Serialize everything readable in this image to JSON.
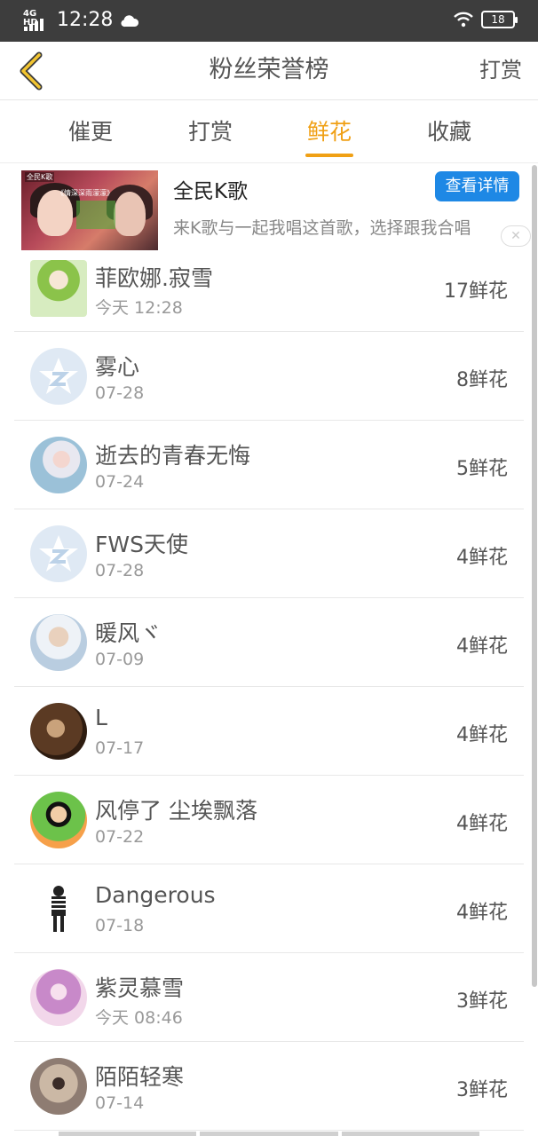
{
  "status_bar": {
    "network": "4G HD",
    "time": "12:28",
    "battery": "18"
  },
  "header": {
    "title": "粉丝荣誉榜",
    "right_action": "打赏"
  },
  "tabs": [
    {
      "label": "催更",
      "active": false
    },
    {
      "label": "打赏",
      "active": false
    },
    {
      "label": "鲜花",
      "active": true
    },
    {
      "label": "收藏",
      "active": false
    }
  ],
  "ad": {
    "title": "全民K歌",
    "button": "查看详情",
    "description": "来K歌与一起我唱这首歌，选择跟我合唱",
    "thumb_brand": "全民K歌",
    "thumb_caption": "《情深深雨濛濛》"
  },
  "fans": [
    {
      "name": "菲欧娜.寂雪",
      "date": "今天 12:28",
      "count": "17鲜花",
      "avatar": "anime-green"
    },
    {
      "name": "雾心",
      "date": "07-28",
      "count": "8鲜花",
      "avatar": "default-star"
    },
    {
      "name": "逝去的青春无悔",
      "date": "07-24",
      "count": "5鲜花",
      "avatar": "photo1"
    },
    {
      "name": "FWS天使",
      "date": "07-28",
      "count": "4鲜花",
      "avatar": "default-star"
    },
    {
      "name": "暖风ヾ",
      "date": "07-09",
      "count": "4鲜花",
      "avatar": "photo2"
    },
    {
      "name": "L",
      "date": "07-17",
      "count": "4鲜花",
      "avatar": "photo3"
    },
    {
      "name": "风停了 尘埃飘落",
      "date": "07-22",
      "count": "4鲜花",
      "avatar": "photo4"
    },
    {
      "name": "Dangerous",
      "date": "07-18",
      "count": "4鲜花",
      "avatar": "photo5"
    },
    {
      "name": "紫灵慕雪",
      "date": "今天 08:46",
      "count": "3鲜花",
      "avatar": "photo6"
    },
    {
      "name": "陌陌轻寒",
      "date": "07-14",
      "count": "3鲜花",
      "avatar": "photo7"
    }
  ],
  "colors": {
    "accent": "#f0a015",
    "status_bar": "#3d3d3d",
    "ad_button": "#1e88e5"
  }
}
